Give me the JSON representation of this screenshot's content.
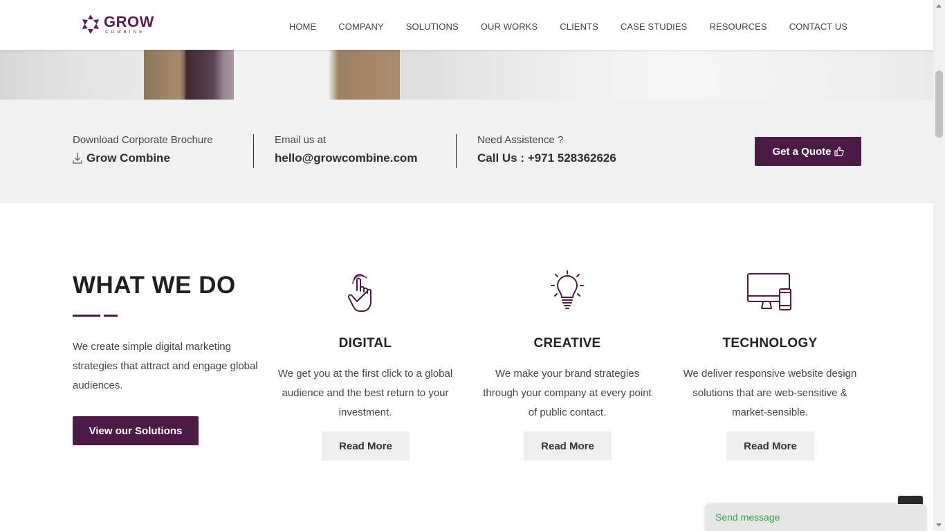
{
  "brand": {
    "name": "GROW",
    "tagline": "COMBINE"
  },
  "nav": [
    {
      "label": "HOME"
    },
    {
      "label": "COMPANY"
    },
    {
      "label": "SOLUTIONS"
    },
    {
      "label": "OUR WORKS"
    },
    {
      "label": "CLIENTS"
    },
    {
      "label": "CASE STUDIES"
    },
    {
      "label": "RESOURCES"
    },
    {
      "label": "CONTACT US"
    }
  ],
  "info": {
    "brochure_label": "Download Corporate Brochure",
    "brochure_value": "Grow Combine",
    "email_label": "Email us at",
    "email_value": "hello@growcombine.com",
    "assist_label": "Need Assistence ?",
    "assist_value": "Call Us : +971 528362626",
    "quote_label": "Get a Quote"
  },
  "what_we_do": {
    "title": "WHAT WE DO",
    "description": "We create simple digital marketing strategies that attract and engage global audiences.",
    "button_label": "View our Solutions",
    "services": [
      {
        "icon": "pointer-hand-icon",
        "title": "DIGITAL",
        "description": "We get you at the first click to a global audience and the best return to your investment.",
        "button": "Read More"
      },
      {
        "icon": "lightbulb-icon",
        "title": "CREATIVE",
        "description": "We make your brand strategies through your company at every point of public contact.",
        "button": "Read More"
      },
      {
        "icon": "devices-icon",
        "title": "TECHNOLOGY",
        "description": "We deliver responsive website design solutions that are web-sensitive & market-sensible.",
        "button": "Read More"
      }
    ]
  },
  "chat": {
    "label": "Send message"
  },
  "colors": {
    "brand": "#4b1a45",
    "chat_text": "#2fa84a",
    "infobar_bg": "#f1f1f1"
  }
}
